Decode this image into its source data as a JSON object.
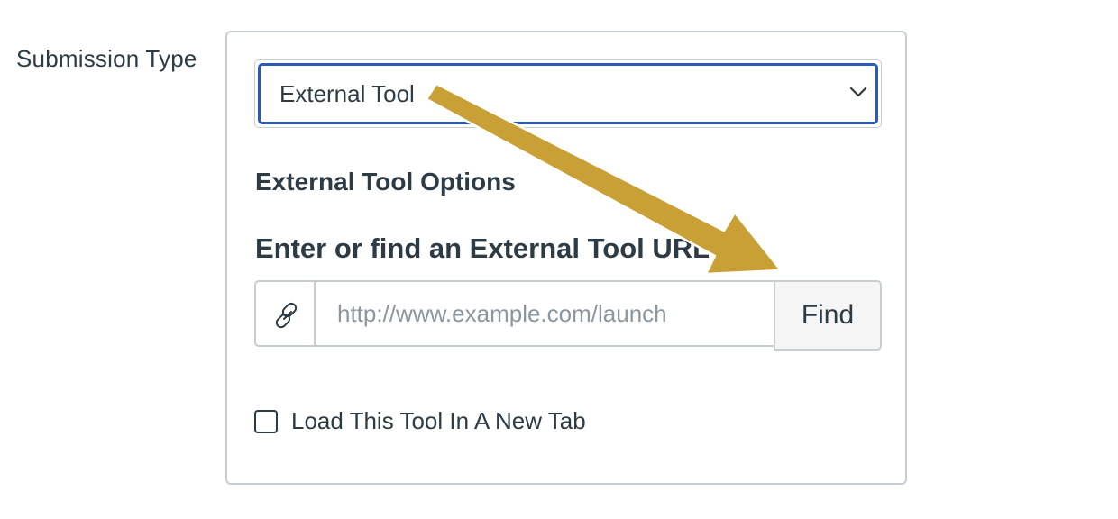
{
  "submission_type": {
    "label": "Submission Type",
    "selected": "External Tool"
  },
  "external_tool": {
    "section_title": "External Tool Options",
    "url_title": "Enter or find an External Tool URL",
    "url_placeholder": "http://www.example.com/launch",
    "url_value": "",
    "find_label": "Find",
    "new_tab_label": "Load This Tool In A New Tab",
    "new_tab_checked": false
  },
  "icons": {
    "link": "link-icon",
    "chevron": "chevron-down-icon",
    "annotation": "arrow-annotation"
  },
  "colors": {
    "text": "#2d3b45",
    "focus_border": "#2b5bb8",
    "border": "#c7cdd1",
    "placeholder": "#8b969e",
    "button_bg": "#f5f5f5",
    "annotation_arrow": "#c9a035"
  }
}
